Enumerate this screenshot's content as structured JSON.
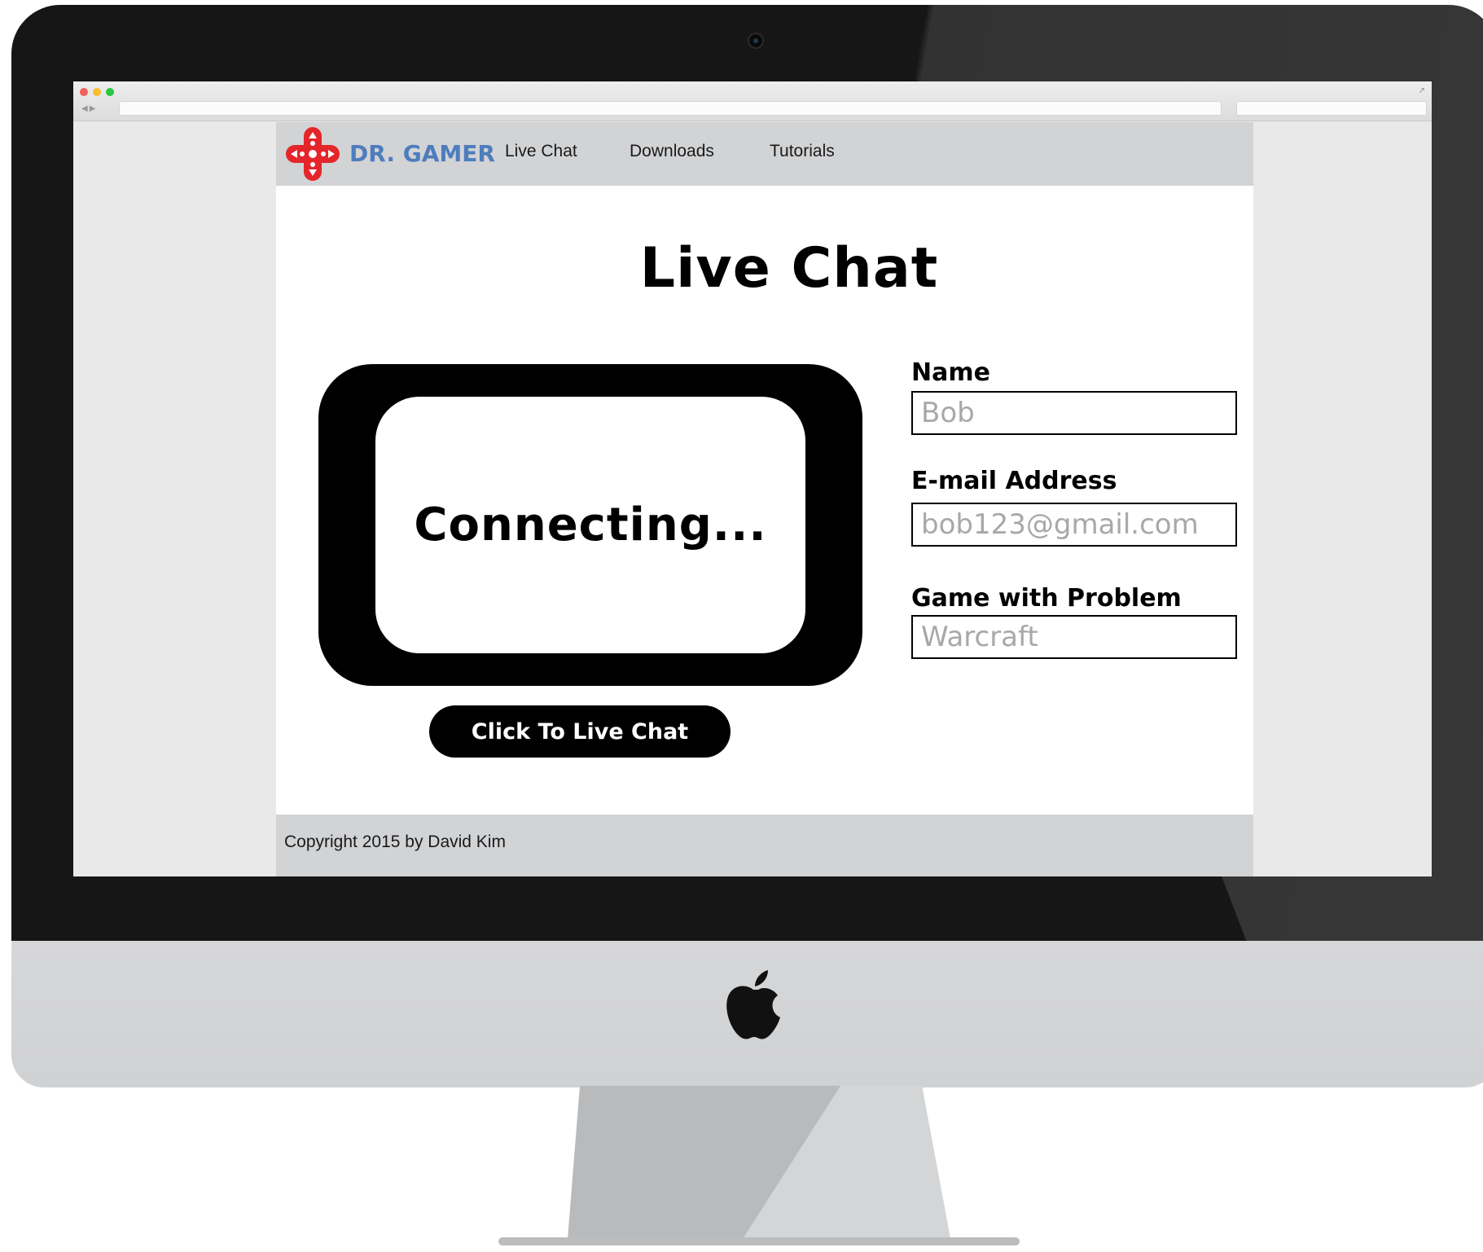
{
  "brand": {
    "name": "DR. GAMER",
    "color": "#4d7dbd",
    "logo_color": "#e4262a"
  },
  "nav": {
    "items": [
      {
        "label": "Live Chat"
      },
      {
        "label": "Downloads"
      },
      {
        "label": "Tutorials"
      }
    ]
  },
  "main": {
    "title": "Live Chat",
    "status_text": "Connecting...",
    "button_label": "Click To Live Chat"
  },
  "form": {
    "fields": [
      {
        "label": "Name",
        "placeholder": "Bob"
      },
      {
        "label": "E-mail Address",
        "placeholder": "bob123@gmail.com"
      },
      {
        "label": "Game with Problem",
        "placeholder": "Warcraft"
      }
    ]
  },
  "footer": {
    "copyright": "Copyright 2015 by David Kim"
  },
  "icons": {
    "logo": "gamepad-cross-icon",
    "device_logo": "apple-icon",
    "camera": "camera-icon"
  }
}
